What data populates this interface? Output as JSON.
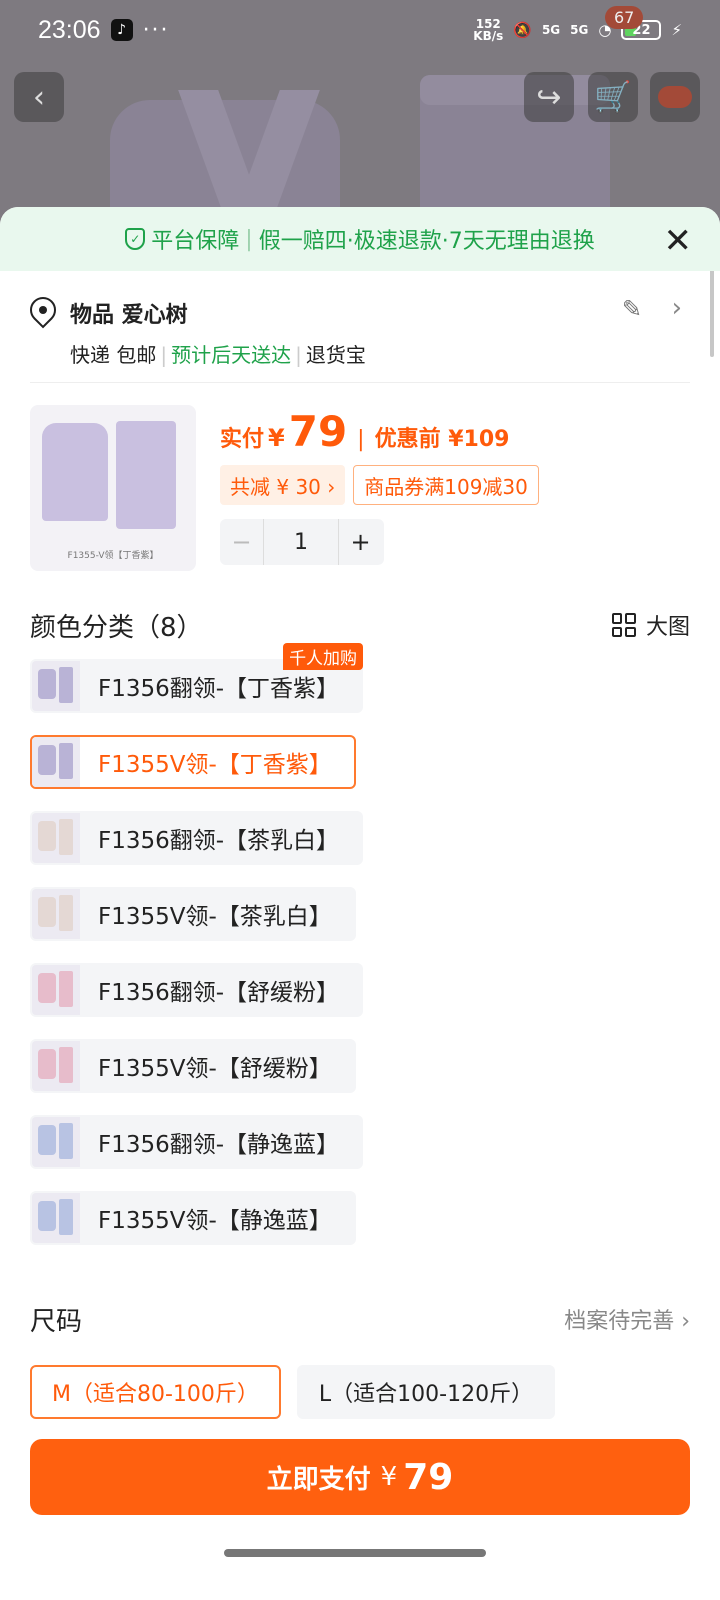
{
  "status_bar": {
    "time": "23:06",
    "dots": "···",
    "speed_top": "152",
    "speed_bottom": "KB/s",
    "net1": "5G",
    "net2": "5G",
    "battery": "22"
  },
  "top_nav": {
    "cart_count": "67"
  },
  "guarantee": {
    "lead": "平台保障",
    "sep": "|",
    "items": "假一赔四·极速退款·7天无理由退换"
  },
  "address": {
    "name": "物品 爱心树",
    "shipping": "快递 包邮",
    "eta": "预计后天送达",
    "returns": "退货宝"
  },
  "product": {
    "thumb_caption": "F1355-V领【丁香紫】",
    "paid_label": "实付",
    "currency": "¥",
    "price": "79",
    "before_label": "优惠前 ¥109",
    "discount_tag": "共减 ¥ 30 ›",
    "coupon_tag": "商品券满109减30",
    "quantity": "1",
    "minus": "−",
    "plus": "+"
  },
  "color_section": {
    "title": "颜色分类（8）",
    "big_view": "大图"
  },
  "variants": [
    {
      "label": "F1356翻领-【丁香紫】",
      "badge": "千人加购",
      "color": "#b9b3d6"
    },
    {
      "label": "F1355V领-【丁香紫】",
      "color": "#b9b3d6",
      "selected": true
    },
    {
      "label": "F1356翻领-【茶乳白】",
      "color": "#e4d8d4"
    },
    {
      "label": "F1355V领-【茶乳白】",
      "color": "#e4d8d4"
    },
    {
      "label": "F1356翻领-【舒缓粉】",
      "color": "#e7bccb"
    },
    {
      "label": "F1355V领-【舒缓粉】",
      "color": "#e7bccb"
    },
    {
      "label": "F1356翻领-【静逸蓝】",
      "color": "#b8c3e3"
    },
    {
      "label": "F1355V领-【静逸蓝】",
      "color": "#b8c3e3"
    }
  ],
  "size_section": {
    "title": "尺码",
    "profile_link": "档案待完善 ›",
    "options": [
      {
        "label": "M（适合80-100斤）",
        "selected": true
      },
      {
        "label": "L（适合100-120斤）"
      }
    ]
  },
  "pay_button": {
    "label": "立即支付",
    "currency": "¥",
    "amount": "79"
  },
  "colors": {
    "accent": "#ff600f",
    "green": "#1fa24a"
  }
}
